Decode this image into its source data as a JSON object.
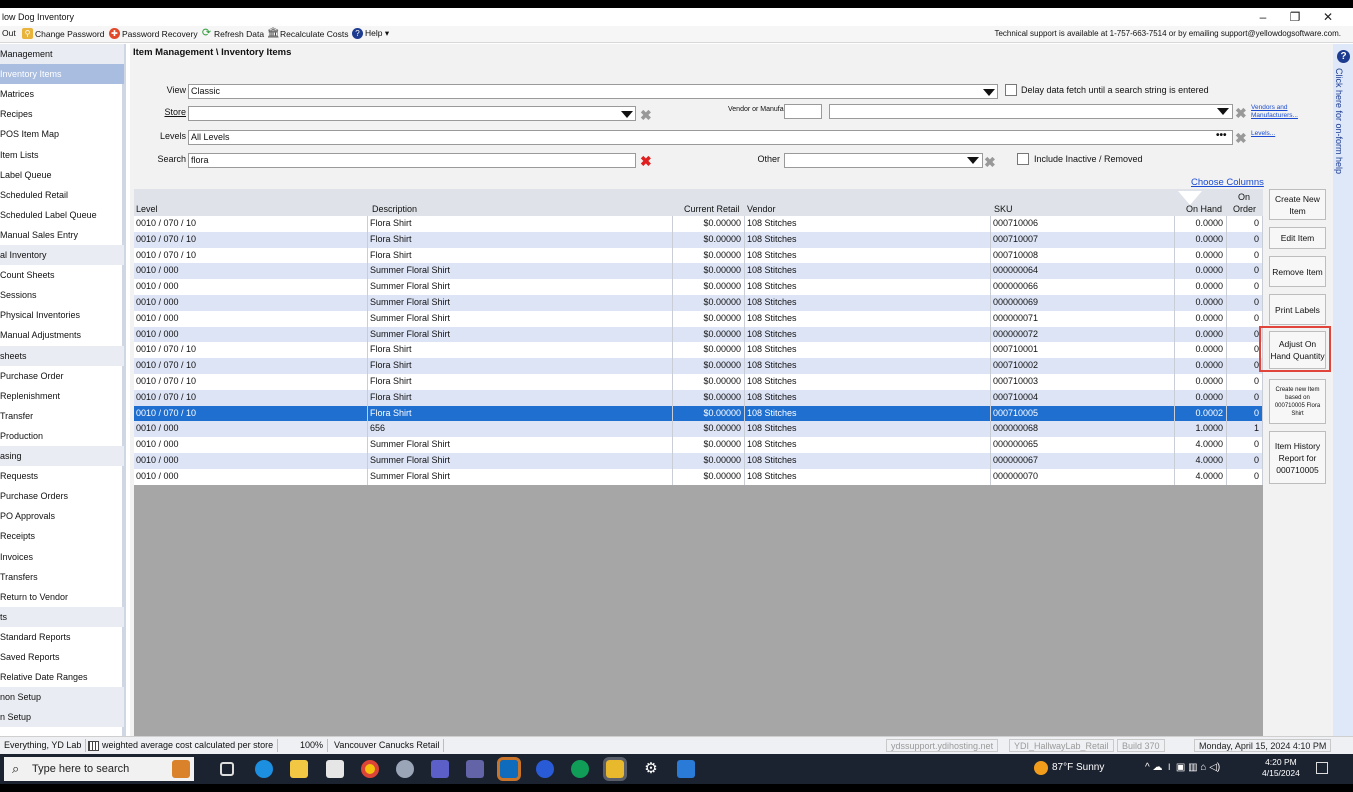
{
  "window": {
    "title": "low Dog Inventory",
    "controls": {
      "minimize": "–",
      "restore": "❐",
      "close": "✕"
    }
  },
  "toolbar": {
    "items": [
      {
        "label": "Out",
        "icon": "logout-icon"
      },
      {
        "label": "Change Password",
        "icon": "key-icon"
      },
      {
        "label": "Password Recovery",
        "icon": "lifebuoy-icon"
      },
      {
        "label": "Refresh Data",
        "icon": "refresh-icon"
      },
      {
        "label": "Recalculate Costs",
        "icon": "bank-icon"
      },
      {
        "label": "Help ▾",
        "icon": "help-icon"
      }
    ],
    "support_text": "Technical support is available at 1-757-663-7514 or by emailing support@yellowdogsoftware.com."
  },
  "sidebar": {
    "items": [
      {
        "label": "Management",
        "type": "header"
      },
      {
        "label": "Inventory Items",
        "type": "selected"
      },
      {
        "label": "Matrices",
        "type": "item"
      },
      {
        "label": "Recipes",
        "type": "item"
      },
      {
        "label": "POS Item Map",
        "type": "item"
      },
      {
        "label": "Item Lists",
        "type": "item"
      },
      {
        "label": "Label Queue",
        "type": "item"
      },
      {
        "label": "Scheduled Retail",
        "type": "item"
      },
      {
        "label": "Scheduled Label Queue",
        "type": "item"
      },
      {
        "label": "Manual Sales Entry",
        "type": "item"
      },
      {
        "label": "al Inventory",
        "type": "header"
      },
      {
        "label": "Count Sheets",
        "type": "item"
      },
      {
        "label": "Sessions",
        "type": "item"
      },
      {
        "label": "Physical Inventories",
        "type": "item"
      },
      {
        "label": "Manual Adjustments",
        "type": "item"
      },
      {
        "label": "sheets",
        "type": "header"
      },
      {
        "label": "Purchase Order",
        "type": "item"
      },
      {
        "label": "Replenishment",
        "type": "item"
      },
      {
        "label": "Transfer",
        "type": "item"
      },
      {
        "label": "Production",
        "type": "item"
      },
      {
        "label": "asing",
        "type": "header"
      },
      {
        "label": "Requests",
        "type": "item"
      },
      {
        "label": "Purchase Orders",
        "type": "item"
      },
      {
        "label": "PO Approvals",
        "type": "item"
      },
      {
        "label": "Receipts",
        "type": "item"
      },
      {
        "label": "Invoices",
        "type": "item"
      },
      {
        "label": "Transfers",
        "type": "item"
      },
      {
        "label": "Return to Vendor",
        "type": "item"
      },
      {
        "label": "ts",
        "type": "header"
      },
      {
        "label": "Standard Reports",
        "type": "item"
      },
      {
        "label": "Saved Reports",
        "type": "item"
      },
      {
        "label": "Relative Date Ranges",
        "type": "item"
      },
      {
        "label": "non Setup",
        "type": "header"
      },
      {
        "label": "n Setup",
        "type": "header"
      }
    ]
  },
  "main": {
    "breadcrumb": "Item Management \\ Inventory Items",
    "filters": {
      "view_label": "View",
      "view_value": "Classic",
      "delay_label": "Delay data fetch until a search string is entered",
      "store_label": "Store",
      "store_value": "",
      "vendor_label": "Vendor or Manufacturer",
      "vendor_code": "",
      "vendor_value": "",
      "vendors_link": "Vendors and Manufacturers...",
      "levels_label": "Levels",
      "levels_value": "All Levels",
      "levels_link": "Levels...",
      "search_label": "Search",
      "search_value": "flora",
      "other_label": "Other",
      "other_value": "",
      "inactive_label": "Include Inactive / Removed",
      "choose_columns": "Choose Columns"
    },
    "grid": {
      "columns": [
        "Level",
        "Description",
        "Current Retail",
        "Vendor",
        "SKU",
        "On Hand",
        "On Order"
      ],
      "on_order_top": "On",
      "on_order_bottom": "Order",
      "rows": [
        [
          "0010 / 070 / 10",
          "Flora Shirt",
          "$0.00000",
          "108 Stitches",
          "000710006",
          "0.0000",
          "0"
        ],
        [
          "0010 / 070 / 10",
          "Flora Shirt",
          "$0.00000",
          "108 Stitches",
          "000710007",
          "0.0000",
          "0"
        ],
        [
          "0010 / 070 / 10",
          "Flora Shirt",
          "$0.00000",
          "108 Stitches",
          "000710008",
          "0.0000",
          "0"
        ],
        [
          "0010 / 000",
          "Summer Floral Shirt",
          "$0.00000",
          "108 Stitches",
          "000000064",
          "0.0000",
          "0"
        ],
        [
          "0010 / 000",
          "Summer Floral Shirt",
          "$0.00000",
          "108 Stitches",
          "000000066",
          "0.0000",
          "0"
        ],
        [
          "0010 / 000",
          "Summer Floral Shirt",
          "$0.00000",
          "108 Stitches",
          "000000069",
          "0.0000",
          "0"
        ],
        [
          "0010 / 000",
          "Summer Floral Shirt",
          "$0.00000",
          "108 Stitches",
          "000000071",
          "0.0000",
          "0"
        ],
        [
          "0010 / 000",
          "Summer Floral Shirt",
          "$0.00000",
          "108 Stitches",
          "000000072",
          "0.0000",
          "0"
        ],
        [
          "0010 / 070 / 10",
          "Flora Shirt",
          "$0.00000",
          "108 Stitches",
          "000710001",
          "0.0000",
          "0"
        ],
        [
          "0010 / 070 / 10",
          "Flora Shirt",
          "$0.00000",
          "108 Stitches",
          "000710002",
          "0.0000",
          "0"
        ],
        [
          "0010 / 070 / 10",
          "Flora Shirt",
          "$0.00000",
          "108 Stitches",
          "000710003",
          "0.0000",
          "0"
        ],
        [
          "0010 / 070 / 10",
          "Flora Shirt",
          "$0.00000",
          "108 Stitches",
          "000710004",
          "0.0000",
          "0"
        ],
        [
          "0010 / 070 / 10",
          "Flora Shirt",
          "$0.00000",
          "108 Stitches",
          "000710005",
          "0.0002",
          "0"
        ],
        [
          "0010 / 000",
          "656",
          "$0.00000",
          "108 Stitches",
          "000000068",
          "1.0000",
          "1"
        ],
        [
          "0010 / 000",
          "Summer Floral Shirt",
          "$0.00000",
          "108 Stitches",
          "000000065",
          "4.0000",
          "0"
        ],
        [
          "0010 / 000",
          "Summer Floral Shirt",
          "$0.00000",
          "108 Stitches",
          "000000067",
          "4.0000",
          "0"
        ],
        [
          "0010 / 000",
          "Summer Floral Shirt",
          "$0.00000",
          "108 Stitches",
          "000000070",
          "4.0000",
          "0"
        ]
      ],
      "selected_row": 12
    },
    "actions": {
      "create": "Create New Item",
      "edit": "Edit Item",
      "remove": "Remove Item",
      "print": "Print Labels",
      "adjust": "Adjust On Hand Quantity",
      "create_based": "Create new Item based on 000710005 Flora Shirt",
      "history": "Item History Report for 000710005"
    }
  },
  "help_strip": {
    "icon": "?",
    "text": "Click here for on-form help"
  },
  "statusbar": {
    "left": "Everything, YD Lab",
    "cost": "weighted average cost calculated per store",
    "zoom": "100%",
    "store": "Vancouver Canucks Retail",
    "host": "ydssupport.ydihosting.net",
    "db": "YDI_HallwayLab_Retail",
    "build": "Build 370",
    "datetime": "Monday, April 15, 2024 4:10 PM"
  },
  "taskbar": {
    "search_placeholder": "Type here to search",
    "weather": "87°F  Sunny",
    "time": "4:20 PM",
    "date": "4/15/2024"
  },
  "colors": {
    "selected_row": "#1f6fd1",
    "alt_row": "#dde4f5",
    "highlight_box": "#e0443a",
    "taskbar": "#1c2330"
  }
}
